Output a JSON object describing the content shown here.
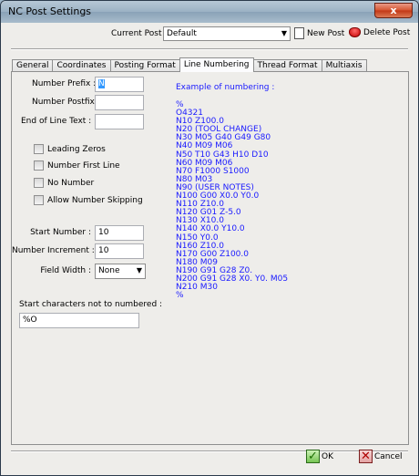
{
  "window": {
    "title": "NC Post Settings",
    "close_glyph": "x"
  },
  "toolbar": {
    "current_post_label": "Current Post -",
    "current_post_value": "Default",
    "new_post_label": "New Post",
    "delete_post_label": "Delete Post"
  },
  "tabs": [
    "General",
    "Coordinates",
    "Posting Format",
    "Line Numbering",
    "Thread Format",
    "Multiaxis"
  ],
  "active_tab": "Line Numbering",
  "form": {
    "number_prefix_label": "Number Prefix :",
    "number_prefix_value": "N",
    "number_postfix_label": "Number Postfix :",
    "number_postfix_value": "",
    "end_of_line_label": "End of Line Text :",
    "end_of_line_value": "",
    "checkboxes": [
      "Leading Zeros",
      "Number First Line",
      "No Number",
      "Allow Number Skipping"
    ],
    "start_number_label": "Start Number :",
    "start_number_value": "10",
    "increment_label": "Number Increment :",
    "increment_value": "10",
    "field_width_label": "Field Width :",
    "field_width_value": "None",
    "start_chars_label": "Start characters not to numbered :",
    "start_chars_value": "%O"
  },
  "example": {
    "title": "Example of numbering :",
    "lines": [
      "%",
      "O4321",
      "N10 Z100.0",
      "N20 (TOOL CHANGE)",
      "N30 M05 G40 G49 G80",
      "N40 M09 M06",
      "N50 T10 G43 H10 D10",
      "N60 M09 M06",
      "N70 F1000 S1000",
      "N80 M03",
      "N90 (USER NOTES)",
      "N100 G00 X0.0 Y0.0",
      "N110 Z10.0",
      "N120 G01 Z-5.0",
      "N130 X10.0",
      "N140 X0.0 Y10.0",
      "N150 Y0.0",
      "N160 Z10.0",
      "N170 G00 Z100.0",
      "N180 M09",
      "N190 G91 G28 Z0.",
      "N200 G91 G28 X0. Y0. M05",
      "N210 M30",
      "%"
    ]
  },
  "buttons": {
    "ok_label": "OK",
    "cancel_label": "Cancel"
  },
  "colors": {
    "example_text": "#1a1aff",
    "selection": "#3399ff"
  }
}
